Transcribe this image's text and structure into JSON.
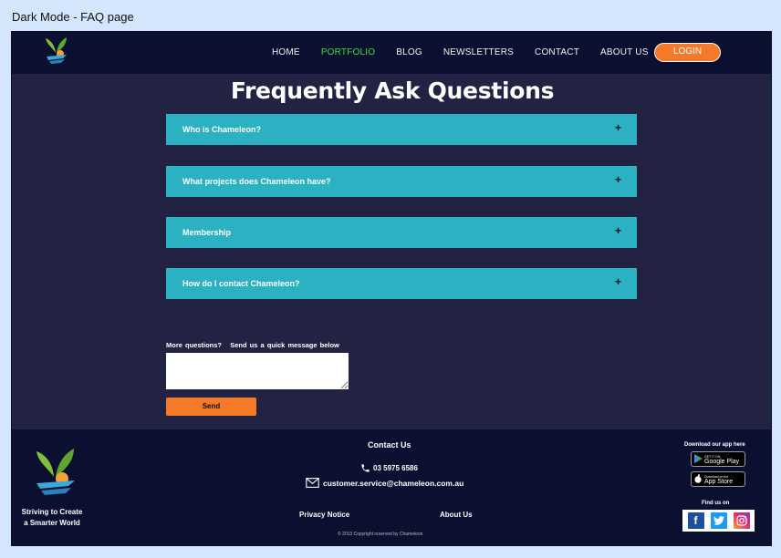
{
  "page_caption": "Dark Mode - FAQ page",
  "nav": {
    "links": [
      "HOME",
      "PORTFOLIO",
      "BLOG",
      "NEWSLETTERS",
      "CONTACT",
      "ABOUT US"
    ],
    "active": "PORTFOLIO",
    "login_label": "LOGIN"
  },
  "faq": {
    "title": "Frequently Ask Questions",
    "items": [
      {
        "question": "Who is Chameleon?",
        "toggle": "+"
      },
      {
        "question": "What projects does Chameleon have?",
        "toggle": "+"
      },
      {
        "question": "Membership",
        "toggle": "+"
      },
      {
        "question": "How do I contact Chameleon?",
        "toggle": "+"
      }
    ]
  },
  "message": {
    "label": "More questions?   Send us a quick message below",
    "value": "",
    "send_label": "Send"
  },
  "footer": {
    "tagline_line1": "Striving to Create",
    "tagline_line2": "a Smarter World",
    "contact_title": "Contact Us",
    "phone": "03 5975 6586",
    "email": "customer.service@chameleon.com.au",
    "privacy_label": "Privacy Notice",
    "about_label": "About Us",
    "copyright": "© 2013 Copyright reserved by Chameleon",
    "download_label": "Download our app here",
    "google_play_small": "GET IT ON",
    "google_play_big": "Google Play",
    "app_store_small": "Download on the",
    "app_store_big": "App Store",
    "find_label": "Find us on",
    "social_icons": [
      "facebook-icon",
      "twitter-icon",
      "instagram-icon"
    ]
  },
  "colors": {
    "nav_bg": "#0b1030",
    "page_bg": "#222342",
    "accent_orange": "#f47a2a",
    "faq_teal": "#2bb1c1",
    "active_link": "#3bdc3b"
  }
}
